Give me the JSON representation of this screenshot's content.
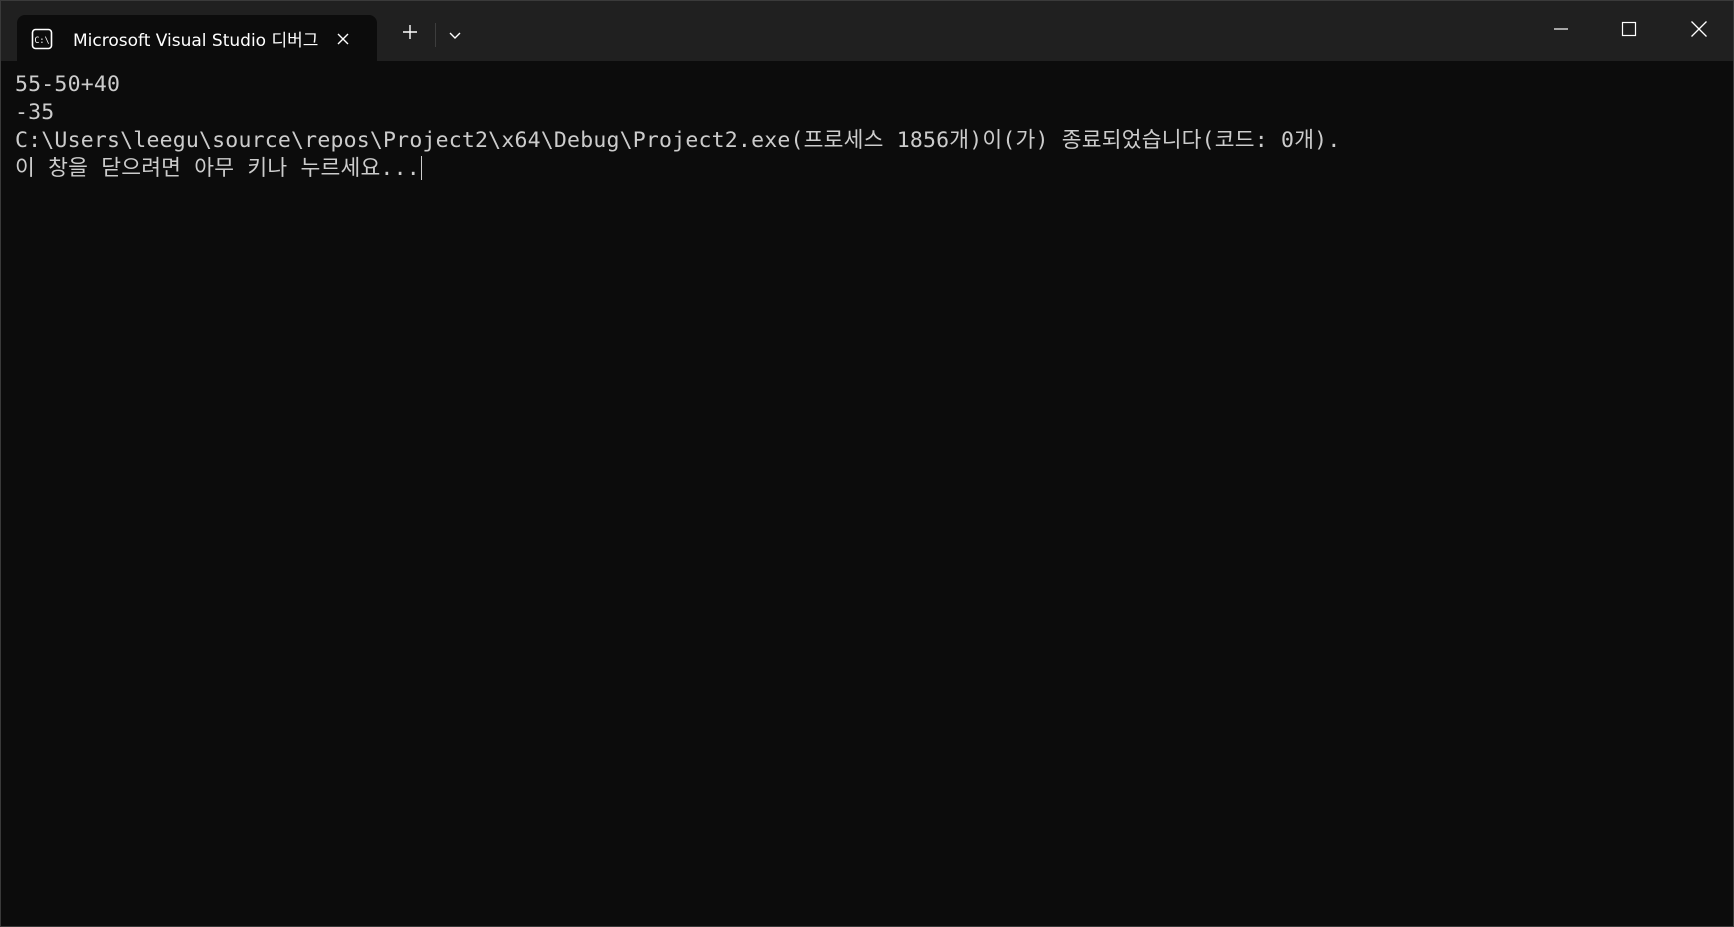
{
  "window": {
    "tab_title": "Microsoft Visual Studio 디버그",
    "tab_icon": "console-icon",
    "new_tab_icon": "plus-icon",
    "dropdown_icon": "chevron-down-icon",
    "controls": [
      "minimize-icon",
      "maximize-icon",
      "close-icon"
    ]
  },
  "terminal": {
    "lines": [
      "55-50+40",
      "-35",
      "C:\\Users\\leegu\\source\\repos\\Project2\\x64\\Debug\\Project2.exe(프로세스 1856개)이(가) 종료되었습니다(코드: 0개).",
      "이 창을 닫으려면 아무 키나 누르세요..."
    ]
  },
  "colors": {
    "background": "#0c0c0c",
    "titlebar": "#202020",
    "text": "#cccccc"
  }
}
